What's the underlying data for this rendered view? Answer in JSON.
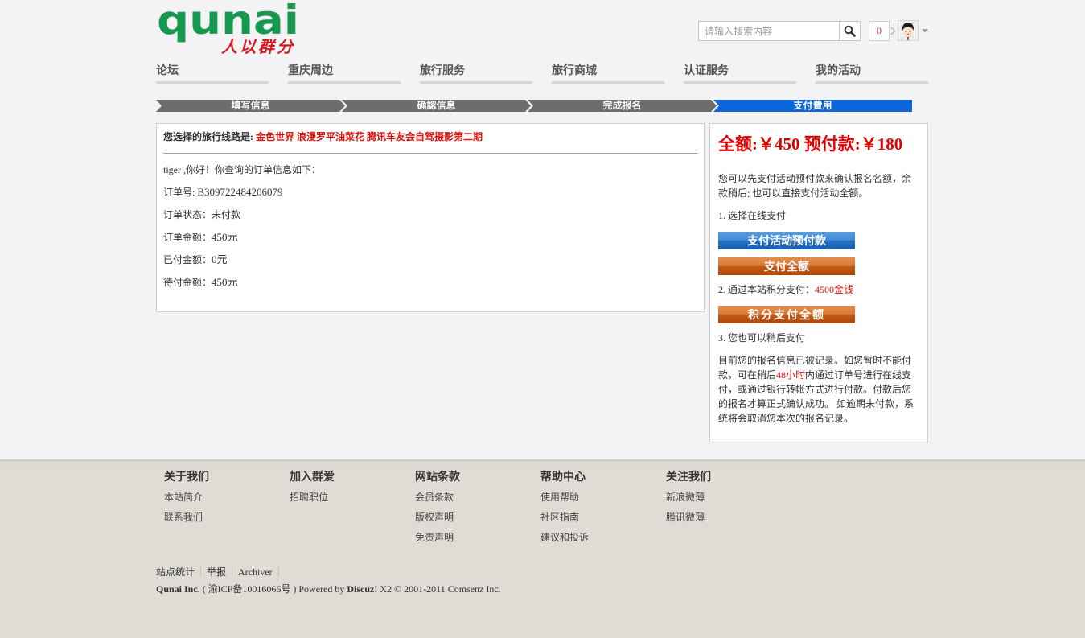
{
  "header": {
    "logo": {
      "text": "qunai",
      "tagline": "人以群分"
    },
    "search": {
      "placeholder": "请输入搜索内容",
      "value": ""
    },
    "notification_count": "0"
  },
  "icons": {
    "search": "search-icon",
    "notification_pointer": "chevron-right-icon",
    "user_menu": "caret-down-icon",
    "avatar": "avatar-icon"
  },
  "nav": {
    "items": [
      {
        "label": "论坛"
      },
      {
        "label": "重庆周边"
      },
      {
        "label": "旅行服务"
      },
      {
        "label": "旅行商城"
      },
      {
        "label": "认证服务"
      },
      {
        "label": "我的活动"
      }
    ]
  },
  "steps": {
    "items": [
      {
        "label": "填写信息",
        "active": false
      },
      {
        "label": "确認信息",
        "active": false
      },
      {
        "label": "完成报名",
        "active": false
      },
      {
        "label": "支付費用",
        "active": true
      }
    ]
  },
  "order": {
    "route_label": "您选择的旅行线路是: ",
    "route_name": "金色世界 浪漫罗平油菜花 腾讯车友会自驾摄影第二期",
    "greeting": "tiger ,你好！你查询的订单信息如下：",
    "fields": [
      {
        "label": "订单号: ",
        "value": "B309722484206079"
      },
      {
        "label": "订单状态：",
        "value": "未付款"
      },
      {
        "label": "订单金额：",
        "value": "450元"
      },
      {
        "label": "已付金额：",
        "value": "0元"
      },
      {
        "label": "待付金额：",
        "value": "450元"
      }
    ]
  },
  "payment": {
    "total_label": "全额:",
    "total_amount": "￥450",
    "deposit_label": "预付款:",
    "deposit_amount": "￥180",
    "intro": "您可以先支付活动预付款来确认报名名额，余款稍后; 也可以直接支付活动全额。",
    "option_online": "1. 选择在线支付",
    "pay_deposit_button": "支付活动预付款",
    "pay_full_button": "支付全额",
    "option_points_label": "2. 通过本站积分支付：",
    "option_points_amount": "4500金钱",
    "pay_points_button": "积分支付全额",
    "option_later": "3. 您也可以稍后支付",
    "notice_before": "目前您的报名信息已被记录。如您暂时不能付款，可在稍后",
    "notice_highlight": "48小时",
    "notice_after": "内通过订单号进行在线支付，或通过银行转帐方式进行付款。付款后您的报名才算正式确认成功。 如逾期未付款，系统将会取消您本次的报名记录。"
  },
  "footer": {
    "columns": [
      {
        "title": "关于我们",
        "links": [
          "本站简介",
          "联系我们"
        ]
      },
      {
        "title": "加入群爱",
        "links": [
          "招聘职位"
        ]
      },
      {
        "title": "网站条款",
        "links": [
          "会员条款",
          "版权声明",
          "免责声明"
        ]
      },
      {
        "title": "帮助中心",
        "links": [
          "使用帮助",
          "社区指南",
          "建议和投诉"
        ]
      },
      {
        "title": "关注我们",
        "links": [
          "新浪微薄",
          "腾讯微薄"
        ]
      }
    ],
    "bottom_links": [
      "站点统计",
      "举报",
      "Archiver"
    ],
    "copyright": {
      "company": "Qunai Inc.",
      "icp": "( 渝ICP备10016066号 )",
      "powered_by": "Powered by",
      "product": "Discuz!",
      "version": "X2",
      "notice": "© 2001-2011 Comsenz Inc."
    }
  },
  "colors": {
    "brand_green": "#16994f",
    "brand_red": "#d41a20",
    "price_red": "#e00000",
    "step_done": "#6d6d6d",
    "step_active": "#0a66da",
    "button_blue": "#2f7fcf",
    "button_orange": "#cc6220",
    "footer_bg": "#dedcd5"
  }
}
